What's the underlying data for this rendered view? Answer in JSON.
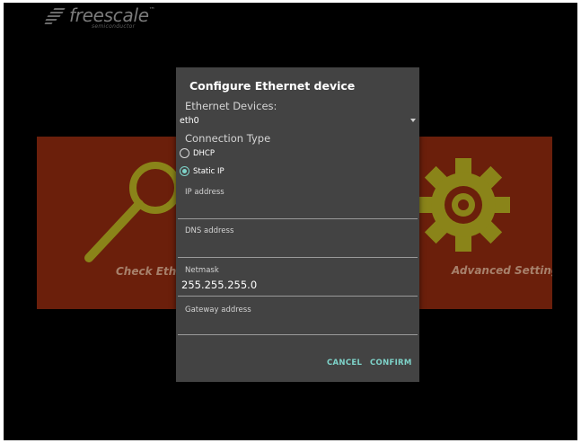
{
  "brand": {
    "name": "freescale",
    "tm": "™",
    "sub": "semiconductor"
  },
  "tiles": {
    "left_caption": "Check Ethe",
    "right_caption": "Advanced Setting",
    "left_icon": "magnifier-icon",
    "right_icon": "gear-icon",
    "tile_color": "#6b1f0b",
    "icon_color": "#8a8419"
  },
  "dialog": {
    "title": "Configure Ethernet device",
    "devices_label": "Ethernet Devices:",
    "device_value": "eth0",
    "connection_type_label": "Connection Type",
    "radio_options": [
      {
        "label": "DHCP",
        "checked": false
      },
      {
        "label": "Static IP",
        "checked": true
      }
    ],
    "fields": [
      {
        "label": "IP address",
        "value": ""
      },
      {
        "label": "DNS address",
        "value": ""
      },
      {
        "label": "Netmask",
        "value": "255.255.255.0"
      },
      {
        "label": "Gateway address",
        "value": ""
      }
    ],
    "cancel_label": "CANCEL",
    "confirm_label": "CONFIRM",
    "accent_color": "#7ed3c9"
  }
}
